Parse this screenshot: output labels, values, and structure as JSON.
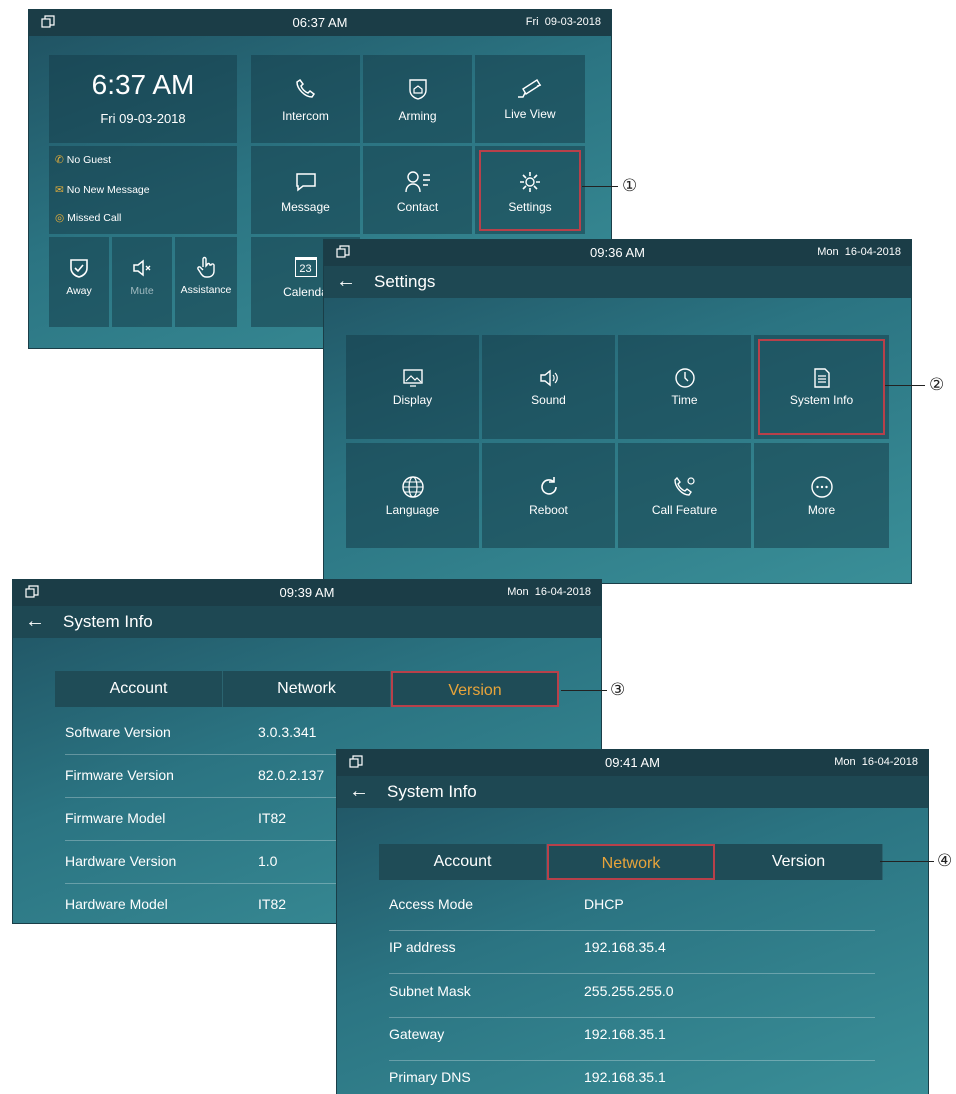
{
  "screen1": {
    "status": {
      "time": "06:37 AM",
      "day": "Fri",
      "date": "09-03-2018"
    },
    "clock": {
      "time": "6:37 AM",
      "date": "Fri 09-03-2018"
    },
    "notices": [
      "No Guest",
      "No New Message",
      "Missed Call"
    ],
    "actions": [
      {
        "label": "Away",
        "icon": "shield-check-icon"
      },
      {
        "label": "Mute",
        "icon": "speaker-mute-icon"
      },
      {
        "label": "Assistance",
        "icon": "hand-pointer-icon"
      }
    ],
    "tiles": [
      {
        "label": "Intercom",
        "icon": "phone-icon"
      },
      {
        "label": "Arming",
        "icon": "home-shield-icon"
      },
      {
        "label": "Live View",
        "icon": "camera-icon"
      },
      {
        "label": "Message",
        "icon": "chat-icon"
      },
      {
        "label": "Contact",
        "icon": "contact-icon"
      },
      {
        "label": "Settings",
        "icon": "gear-icon"
      },
      {
        "label": "Calenda",
        "icon": "calendar-icon",
        "day": "23"
      }
    ]
  },
  "screen2": {
    "status": {
      "time": "09:36 AM",
      "day": "Mon",
      "date": "16-04-2018"
    },
    "title": "Settings",
    "tiles": [
      {
        "label": "Display",
        "icon": "display-icon"
      },
      {
        "label": "Sound",
        "icon": "speaker-icon"
      },
      {
        "label": "Time",
        "icon": "clock-icon"
      },
      {
        "label": "System Info",
        "icon": "document-icon"
      },
      {
        "label": "Language",
        "icon": "globe-icon"
      },
      {
        "label": "Reboot",
        "icon": "reboot-icon"
      },
      {
        "label": "Call Feature",
        "icon": "call-gear-icon"
      },
      {
        "label": "More",
        "icon": "more-icon"
      }
    ]
  },
  "screen3": {
    "status": {
      "time": "09:39 AM",
      "day": "Mon",
      "date": "16-04-2018"
    },
    "title": "System Info",
    "tabs": [
      "Account",
      "Network",
      "Version"
    ],
    "active_tab": "Version",
    "rows": [
      {
        "key": "Software Version",
        "value": "3.0.3.341"
      },
      {
        "key": "Firmware Version",
        "value": "82.0.2.137"
      },
      {
        "key": "Firmware Model",
        "value": "IT82"
      },
      {
        "key": "Hardware Version",
        "value": "1.0"
      },
      {
        "key": "Hardware Model",
        "value": "IT82"
      }
    ]
  },
  "screen4": {
    "status": {
      "time": "09:41 AM",
      "day": "Mon",
      "date": "16-04-2018"
    },
    "title": "System Info",
    "tabs": [
      "Account",
      "Network",
      "Version"
    ],
    "active_tab": "Network",
    "rows": [
      {
        "key": "Access Mode",
        "value": "DHCP"
      },
      {
        "key": "IP address",
        "value": "192.168.35.4"
      },
      {
        "key": "Subnet Mask",
        "value": "255.255.255.0"
      },
      {
        "key": "Gateway",
        "value": "192.168.35.1"
      },
      {
        "key": "Primary DNS",
        "value": "192.168.35.1"
      }
    ]
  },
  "callouts": [
    "①",
    "②",
    "③",
    "④"
  ],
  "colors": {
    "accent": "#e8a43a",
    "highlight": "#b8404a",
    "notice": "#e8b03a",
    "status_bar": "#1b3d47"
  }
}
